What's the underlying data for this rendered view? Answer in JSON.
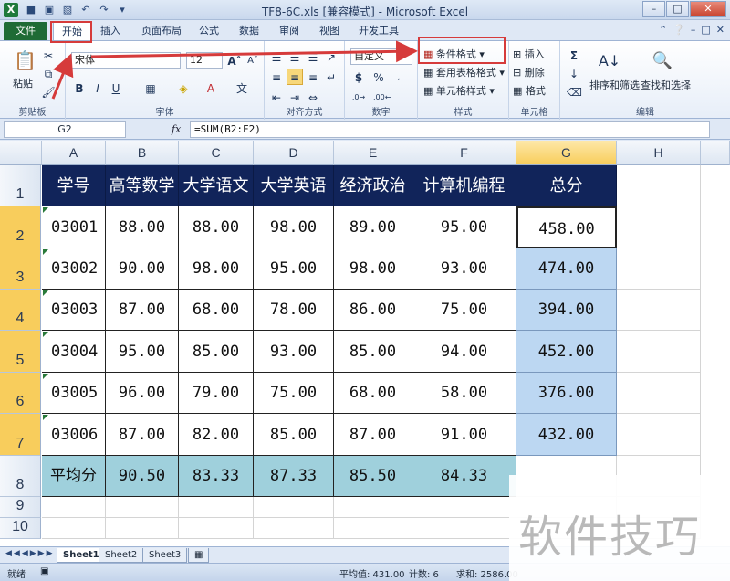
{
  "window": {
    "title": "TF8-6C.xls  [兼容模式] - Microsoft Excel",
    "app_icon": "X"
  },
  "tabs": [
    {
      "label": "文件"
    },
    {
      "label": "开始"
    },
    {
      "label": "插入"
    },
    {
      "label": "页面布局"
    },
    {
      "label": "公式"
    },
    {
      "label": "数据"
    },
    {
      "label": "审阅"
    },
    {
      "label": "视图"
    },
    {
      "label": "开发工具"
    }
  ],
  "ribbon": {
    "clipboard": {
      "paste": "粘贴",
      "label": "剪贴板"
    },
    "font": {
      "name": "宋体",
      "size": "12",
      "label": "字体",
      "bold": "B",
      "italic": "I",
      "underline": "U"
    },
    "alignment": {
      "label": "对齐方式"
    },
    "number": {
      "format": "自定义",
      "currency": "$",
      "percent": "%",
      "label": "数字"
    },
    "styles": {
      "conditional": "条件格式",
      "table": "套用表格格式",
      "cell": "单元格样式",
      "label": "样式"
    },
    "cells": {
      "insert": "插入",
      "delete": "删除",
      "format": "格式",
      "label": "单元格"
    },
    "editing": {
      "sort": "排序和筛选",
      "find": "查找和选择",
      "label": "编辑",
      "sum": "Σ"
    }
  },
  "formula_bar": {
    "name_box": "G2",
    "fx": "fx",
    "formula": "=SUM(B2:F2)"
  },
  "columns": [
    "A",
    "B",
    "C",
    "D",
    "E",
    "F",
    "G",
    "H"
  ],
  "rows": [
    "1",
    "2",
    "3",
    "4",
    "5",
    "6",
    "7",
    "8",
    "9",
    "10"
  ],
  "table": {
    "headers": [
      "学号",
      "高等数学",
      "大学语文",
      "大学英语",
      "经济政治",
      "计算机编程",
      "总分"
    ],
    "data": [
      [
        "03001",
        "88.00",
        "88.00",
        "98.00",
        "89.00",
        "95.00",
        "458.00"
      ],
      [
        "03002",
        "90.00",
        "98.00",
        "95.00",
        "98.00",
        "93.00",
        "474.00"
      ],
      [
        "03003",
        "87.00",
        "68.00",
        "78.00",
        "86.00",
        "75.00",
        "394.00"
      ],
      [
        "03004",
        "95.00",
        "85.00",
        "93.00",
        "85.00",
        "94.00",
        "452.00"
      ],
      [
        "03005",
        "96.00",
        "79.00",
        "75.00",
        "68.00",
        "58.00",
        "376.00"
      ],
      [
        "03006",
        "87.00",
        "82.00",
        "85.00",
        "87.00",
        "91.00",
        "432.00"
      ]
    ],
    "average": [
      "平均分",
      "90.50",
      "83.33",
      "87.33",
      "85.50",
      "84.33"
    ]
  },
  "sheets": [
    "Sheet1",
    "Sheet2",
    "Sheet3"
  ],
  "status": {
    "ready": "就绪",
    "average": "平均值: 431.00",
    "count": "计数: 6",
    "sum": "求和: 2586.00"
  },
  "watermark": "软件技巧",
  "colors": {
    "header_bg": "#11245a",
    "total_bg": "#bcd7f2",
    "avg_bg": "#9fd0dc",
    "selected_header": "#f8cd5c",
    "annotation": "#d63b3b"
  }
}
